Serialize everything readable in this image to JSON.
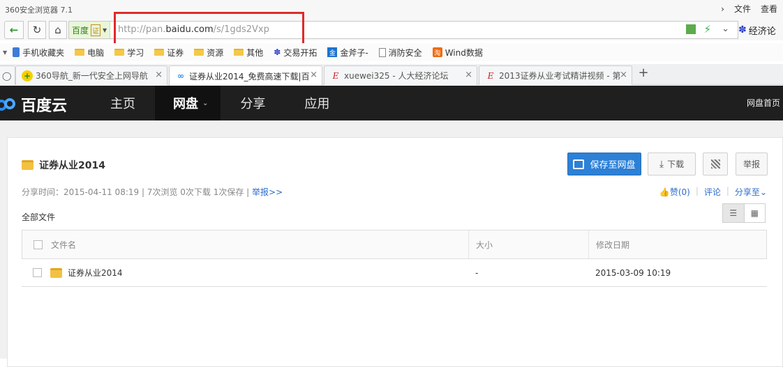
{
  "window": {
    "title": "360安全浏览器 7.1"
  },
  "titlebar": {
    "menu_file": "文件",
    "menu_view": "查看"
  },
  "address": {
    "identity_label": "百度",
    "cert_label": "证",
    "url_prefix": "http://pan.",
    "url_host": "baidu.com",
    "url_path": "/s/1gds2Vxp",
    "search_label": "经济论"
  },
  "bookmarks": [
    {
      "label": "手机收藏夹",
      "icon": "phone-icon"
    },
    {
      "label": "电脑",
      "icon": "folder-icon"
    },
    {
      "label": "学习",
      "icon": "folder-icon"
    },
    {
      "label": "证券",
      "icon": "folder-icon"
    },
    {
      "label": "资源",
      "icon": "folder-icon"
    },
    {
      "label": "其他",
      "icon": "folder-icon"
    },
    {
      "label": "交易开拓",
      "icon": "baidu-paw-icon"
    },
    {
      "label": "金斧子-",
      "icon": "jinfuzi-icon"
    },
    {
      "label": "消防安全",
      "icon": "doc-icon"
    },
    {
      "label": "Wind数据",
      "icon": "taobao-icon"
    }
  ],
  "tabs": [
    {
      "label": "360导航_新一代安全上网导航",
      "icon": "360-icon"
    },
    {
      "label": "证券从业2014_免费高速下载|百",
      "icon": "baidu-cloud-icon"
    },
    {
      "label": "xuewei325 - 人大经济论坛",
      "icon": "pinggu-e-icon"
    },
    {
      "label": "2013证券从业考试精讲视频 - 第",
      "icon": "pinggu-e-icon"
    }
  ],
  "baidu": {
    "logo_text": "百度云",
    "nav": [
      {
        "label": "主页"
      },
      {
        "label": "网盘"
      },
      {
        "label": "分享"
      },
      {
        "label": "应用"
      }
    ],
    "home_link": "网盘首页"
  },
  "share": {
    "folder_title": "证券从业2014",
    "save_label": "保存至网盘",
    "download_label": "下载",
    "report_label": "举报",
    "meta_text": "分享时间：2015-04-11 08:19 | 7次浏览  0次下载  1次保存 | ",
    "meta_report": "举报>>",
    "like_label": "赞(0)",
    "comment_label": "评论",
    "share_to_label": "分享至",
    "all_files": "全部文件"
  },
  "table": {
    "headers": {
      "name": "文件名",
      "size": "大小",
      "date": "修改日期"
    },
    "rows": [
      {
        "name": "证券从业2014",
        "size": "-",
        "date": "2015-03-09 10:19"
      }
    ]
  },
  "colors": {
    "accent": "#2c80d6",
    "header_bg": "#1f1f1f",
    "highlight": "#e02a2a"
  }
}
